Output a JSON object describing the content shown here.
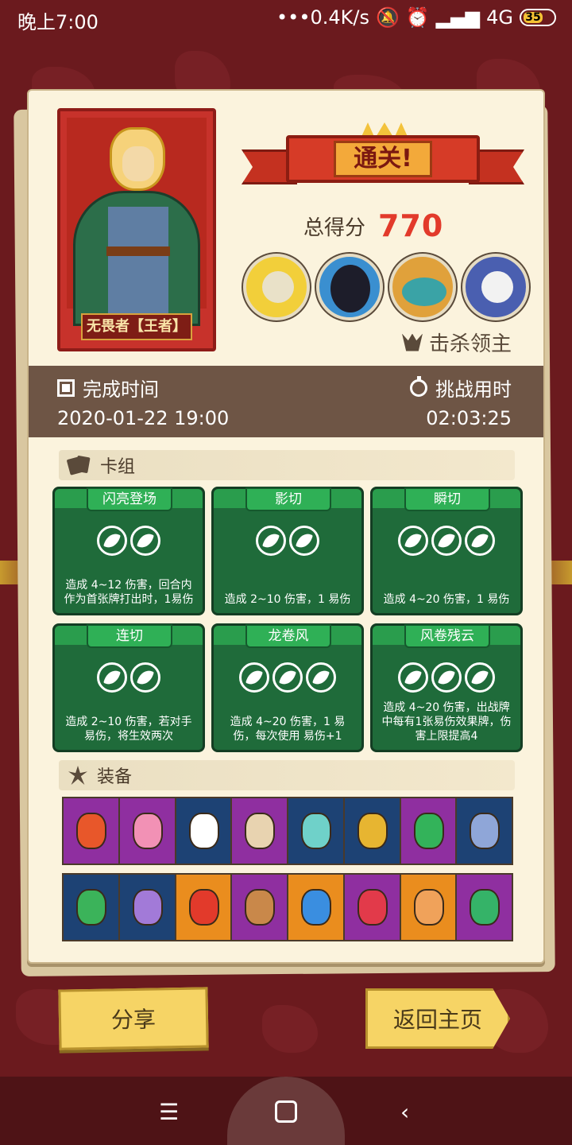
{
  "status": {
    "time": "晚上7:00",
    "speed": "0.4K/s",
    "signal": "4G",
    "battery": "35"
  },
  "hero": {
    "name": "无畏者【王者】"
  },
  "result": {
    "title": "通关!",
    "score_label": "总得分",
    "score": "770",
    "kill_label": "击杀领主"
  },
  "bosses": [
    {
      "icon": "boss-wizard-icon",
      "color": "#f2cf3a"
    },
    {
      "icon": "boss-shadow-icon",
      "color": "#1d1d2a"
    },
    {
      "icon": "boss-fish-icon",
      "color": "#3aa3a6"
    },
    {
      "icon": "boss-skull-knight-icon",
      "color": "#4a5fb0"
    }
  ],
  "times": {
    "finish_label": "完成时间",
    "finish_value": "2020-01-22 19:00",
    "duration_label": "挑战用时",
    "duration_value": "02:03:25"
  },
  "deck": {
    "title": "卡组",
    "cards": [
      {
        "name": "闪亮登场",
        "coins": 2,
        "desc": "造成 4~12 伤害，回合内作为首张牌打出时，1易伤"
      },
      {
        "name": "影切",
        "coins": 2,
        "desc": "造成 2~10 伤害，1 易伤"
      },
      {
        "name": "瞬切",
        "coins": 3,
        "desc": "造成 4~20 伤害，1 易伤"
      },
      {
        "name": "连切",
        "coins": 2,
        "desc": "造成 2~10 伤害，若对手易伤，将生效两次"
      },
      {
        "name": "龙卷风",
        "coins": 3,
        "desc": "造成 4~20 伤害，1 易伤，每次使用 易伤+1"
      },
      {
        "name": "风卷残云",
        "coins": 3,
        "desc": "造成 4~20 伤害，出战牌中每有1张易伤效果牌，伤害上限提高4"
      }
    ]
  },
  "equipment": {
    "title": "装备",
    "row1": [
      {
        "icon": "feather-icon",
        "bg": "#8f2fa0",
        "color": "#e8572a"
      },
      {
        "icon": "crystal-icon",
        "bg": "#8f2fa0",
        "color": "#f291b5"
      },
      {
        "icon": "skull-icon",
        "bg": "#1d4274",
        "color": "#ffffff"
      },
      {
        "icon": "scroll-icon",
        "bg": "#8f2fa0",
        "color": "#e8d3b0"
      },
      {
        "icon": "chest-icon",
        "bg": "#1d4274",
        "color": "#6fd1c9"
      },
      {
        "icon": "key-icon",
        "bg": "#1d4274",
        "color": "#e7b531"
      },
      {
        "icon": "totem-icon",
        "bg": "#8f2fa0",
        "color": "#33b35a"
      },
      {
        "icon": "bracer-icon",
        "bg": "#1d4274",
        "color": "#8fa6d8"
      }
    ],
    "row2": [
      {
        "icon": "clover-icon",
        "bg": "#1d4274",
        "color": "#3bb35a"
      },
      {
        "icon": "helmet-icon",
        "bg": "#1d4274",
        "color": "#a27ad8"
      },
      {
        "icon": "fire-glyph-icon",
        "bg": "#ea8d1e",
        "color": "#e23a2b"
      },
      {
        "icon": "boot-icon",
        "bg": "#8f2fa0",
        "color": "#c9884a"
      },
      {
        "icon": "ice-crystal-icon",
        "bg": "#ea8d1e",
        "color": "#3a8ee0"
      },
      {
        "icon": "amulet-icon",
        "bg": "#8f2fa0",
        "color": "#e23a4a"
      },
      {
        "icon": "dice-icon",
        "bg": "#ea8d1e",
        "color": "#f0a25a"
      },
      {
        "icon": "wind-stone-icon",
        "bg": "#8f2fa0",
        "color": "#35b368"
      }
    ]
  },
  "buttons": {
    "share": "分享",
    "home": "返回主页"
  }
}
